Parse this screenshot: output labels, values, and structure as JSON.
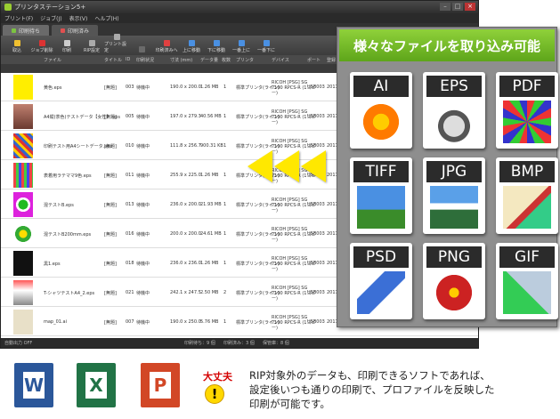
{
  "window": {
    "title": "プリンタステーション5+",
    "menu": [
      "プリント(F)",
      "ジョブ(J)",
      "表示(V)",
      "ヘルプ(H)"
    ],
    "tabs": [
      "印刷待ち",
      "印刷済み"
    ],
    "toolbar": [
      "取込",
      "ジョブ削除",
      "印刷",
      "RIP設定",
      "プリント設定",
      "",
      "印刷済みへ",
      "上に移動",
      "下に移動",
      "一番上に",
      "一番下に"
    ],
    "columns": [
      "ファイル",
      "タイトル",
      "ID",
      "印刷状況",
      "寸法 (mm)",
      "データ量",
      "枚数",
      "プリンタ",
      "デバイス",
      "ポート",
      "登録"
    ]
  },
  "jobs": [
    {
      "file": "黄色.eps",
      "title": "[無題]",
      "id": "003",
      "status": "待機中",
      "size": "190.0 x 200.0",
      "data": "1.26 MB",
      "count": "1",
      "printer": "標準プリンタ(ライン)",
      "device": "RICOH [PSG] SG 7100 RPCS-R (1コピー)",
      "port": "USB003",
      "date": "2017-"
    },
    {
      "file": "A4縦(茶色)テストデータ【女性】.eps",
      "title": "[無題]",
      "id": "005",
      "status": "待機中",
      "size": "197.0 x 279.3",
      "data": "40.56 MB",
      "count": "1",
      "printer": "標準プリンタ(ライン)",
      "device": "RICOH [PSG] SG 7100 RPCS-R (1コピー)",
      "port": "USB003",
      "date": "2017-"
    },
    {
      "file": "印刷テスト用A4シートデータ.eps",
      "title": "[無題]",
      "id": "010",
      "status": "待機中",
      "size": "111.8 x 256.7",
      "data": "900.31 KB",
      "count": "1",
      "printer": "標準プリンタ(ライン)",
      "device": "RICOH [PSG] SG 7100 RPCS-R (1コピー)",
      "port": "USB003",
      "date": "2017-"
    },
    {
      "file": "表着用ラテママ9色.eps",
      "title": "[無題]",
      "id": "011",
      "status": "待機中",
      "size": "255.9 x 225.0",
      "data": "1.26 MB",
      "count": "1",
      "printer": "標準プリンタ(ライン)",
      "device": "RICOH [PSG] SG 7100 RPCS-R (1コピー)",
      "port": "USB003",
      "date": "2017-"
    },
    {
      "file": "混テストB.eps",
      "title": "[無題]",
      "id": "013",
      "status": "待機中",
      "size": "236.0 x 200.0",
      "data": "21.93 MB",
      "count": "1",
      "printer": "標準プリンタ(ライン)",
      "device": "RICOH [PSG] SG 7100 RPCS-R (1コピー)",
      "port": "USB003",
      "date": "2017-"
    },
    {
      "file": "混テストB200mm.eps",
      "title": "[無題]",
      "id": "016",
      "status": "待機中",
      "size": "200.0 x 200.0",
      "data": "24.61 MB",
      "count": "1",
      "printer": "標準プリンタ(ライン)",
      "device": "RICOH [PSG] SG 7100 RPCS-R (1コピー)",
      "port": "USB003",
      "date": "2017-"
    },
    {
      "file": "黒1.eps",
      "title": "[無題]",
      "id": "018",
      "status": "待機中",
      "size": "236.0 x 236.0",
      "data": "1.26 MB",
      "count": "1",
      "printer": "標準プリンタ(ライン)",
      "device": "RICOH [PSG] SG 7100 RPCS-R (1コピー)",
      "port": "USB003",
      "date": "2017-"
    },
    {
      "file": "T-シャツテストA4_2.eps",
      "title": "[無題]",
      "id": "021",
      "status": "待機中",
      "size": "242.1 x 247.5",
      "data": "2.50 MB",
      "count": "2",
      "printer": "標準プリンタ(ライン)",
      "device": "RICOH [PSG] SG 7100 RPCS-R (1コピー)",
      "port": "USB003",
      "date": "2017-"
    },
    {
      "file": "map_01.ai",
      "title": "[無題]",
      "id": "007",
      "status": "待機中",
      "size": "190.0 x 250.0",
      "data": "5.76 MB",
      "count": "1",
      "printer": "標準プリンタ(ライン)",
      "device": "RICOH [PSG] SG 7100 RPCS-R (1コピー)",
      "port": "USB003",
      "date": "2017-"
    }
  ],
  "statusbar": {
    "left": "自動出力 OFF",
    "waiting": "印刷待ち：9 個",
    "done": "印刷済み：3 個",
    "kept": "保管庫：8 個"
  },
  "panel": {
    "banner": "様々なファイルを取り込み可能",
    "formats": [
      "AI",
      "EPS",
      "PDF",
      "TIFF",
      "JPG",
      "BMP",
      "PSD",
      "PNG",
      "GIF"
    ]
  },
  "office": [
    "W",
    "X",
    "P"
  ],
  "warning": {
    "title": "大丈夫",
    "mark": "!",
    "lines": [
      "RIP対象外のデータも、印刷できるソフトであれば、",
      "設定後いつも通りの印刷で、プロファイルを反映した",
      "印刷が可能です。"
    ]
  },
  "colors": {
    "banner": "#6ab425",
    "word": "#2b579a",
    "excel": "#217346",
    "powerpoint": "#d24726",
    "arrow": "#ffe800"
  }
}
